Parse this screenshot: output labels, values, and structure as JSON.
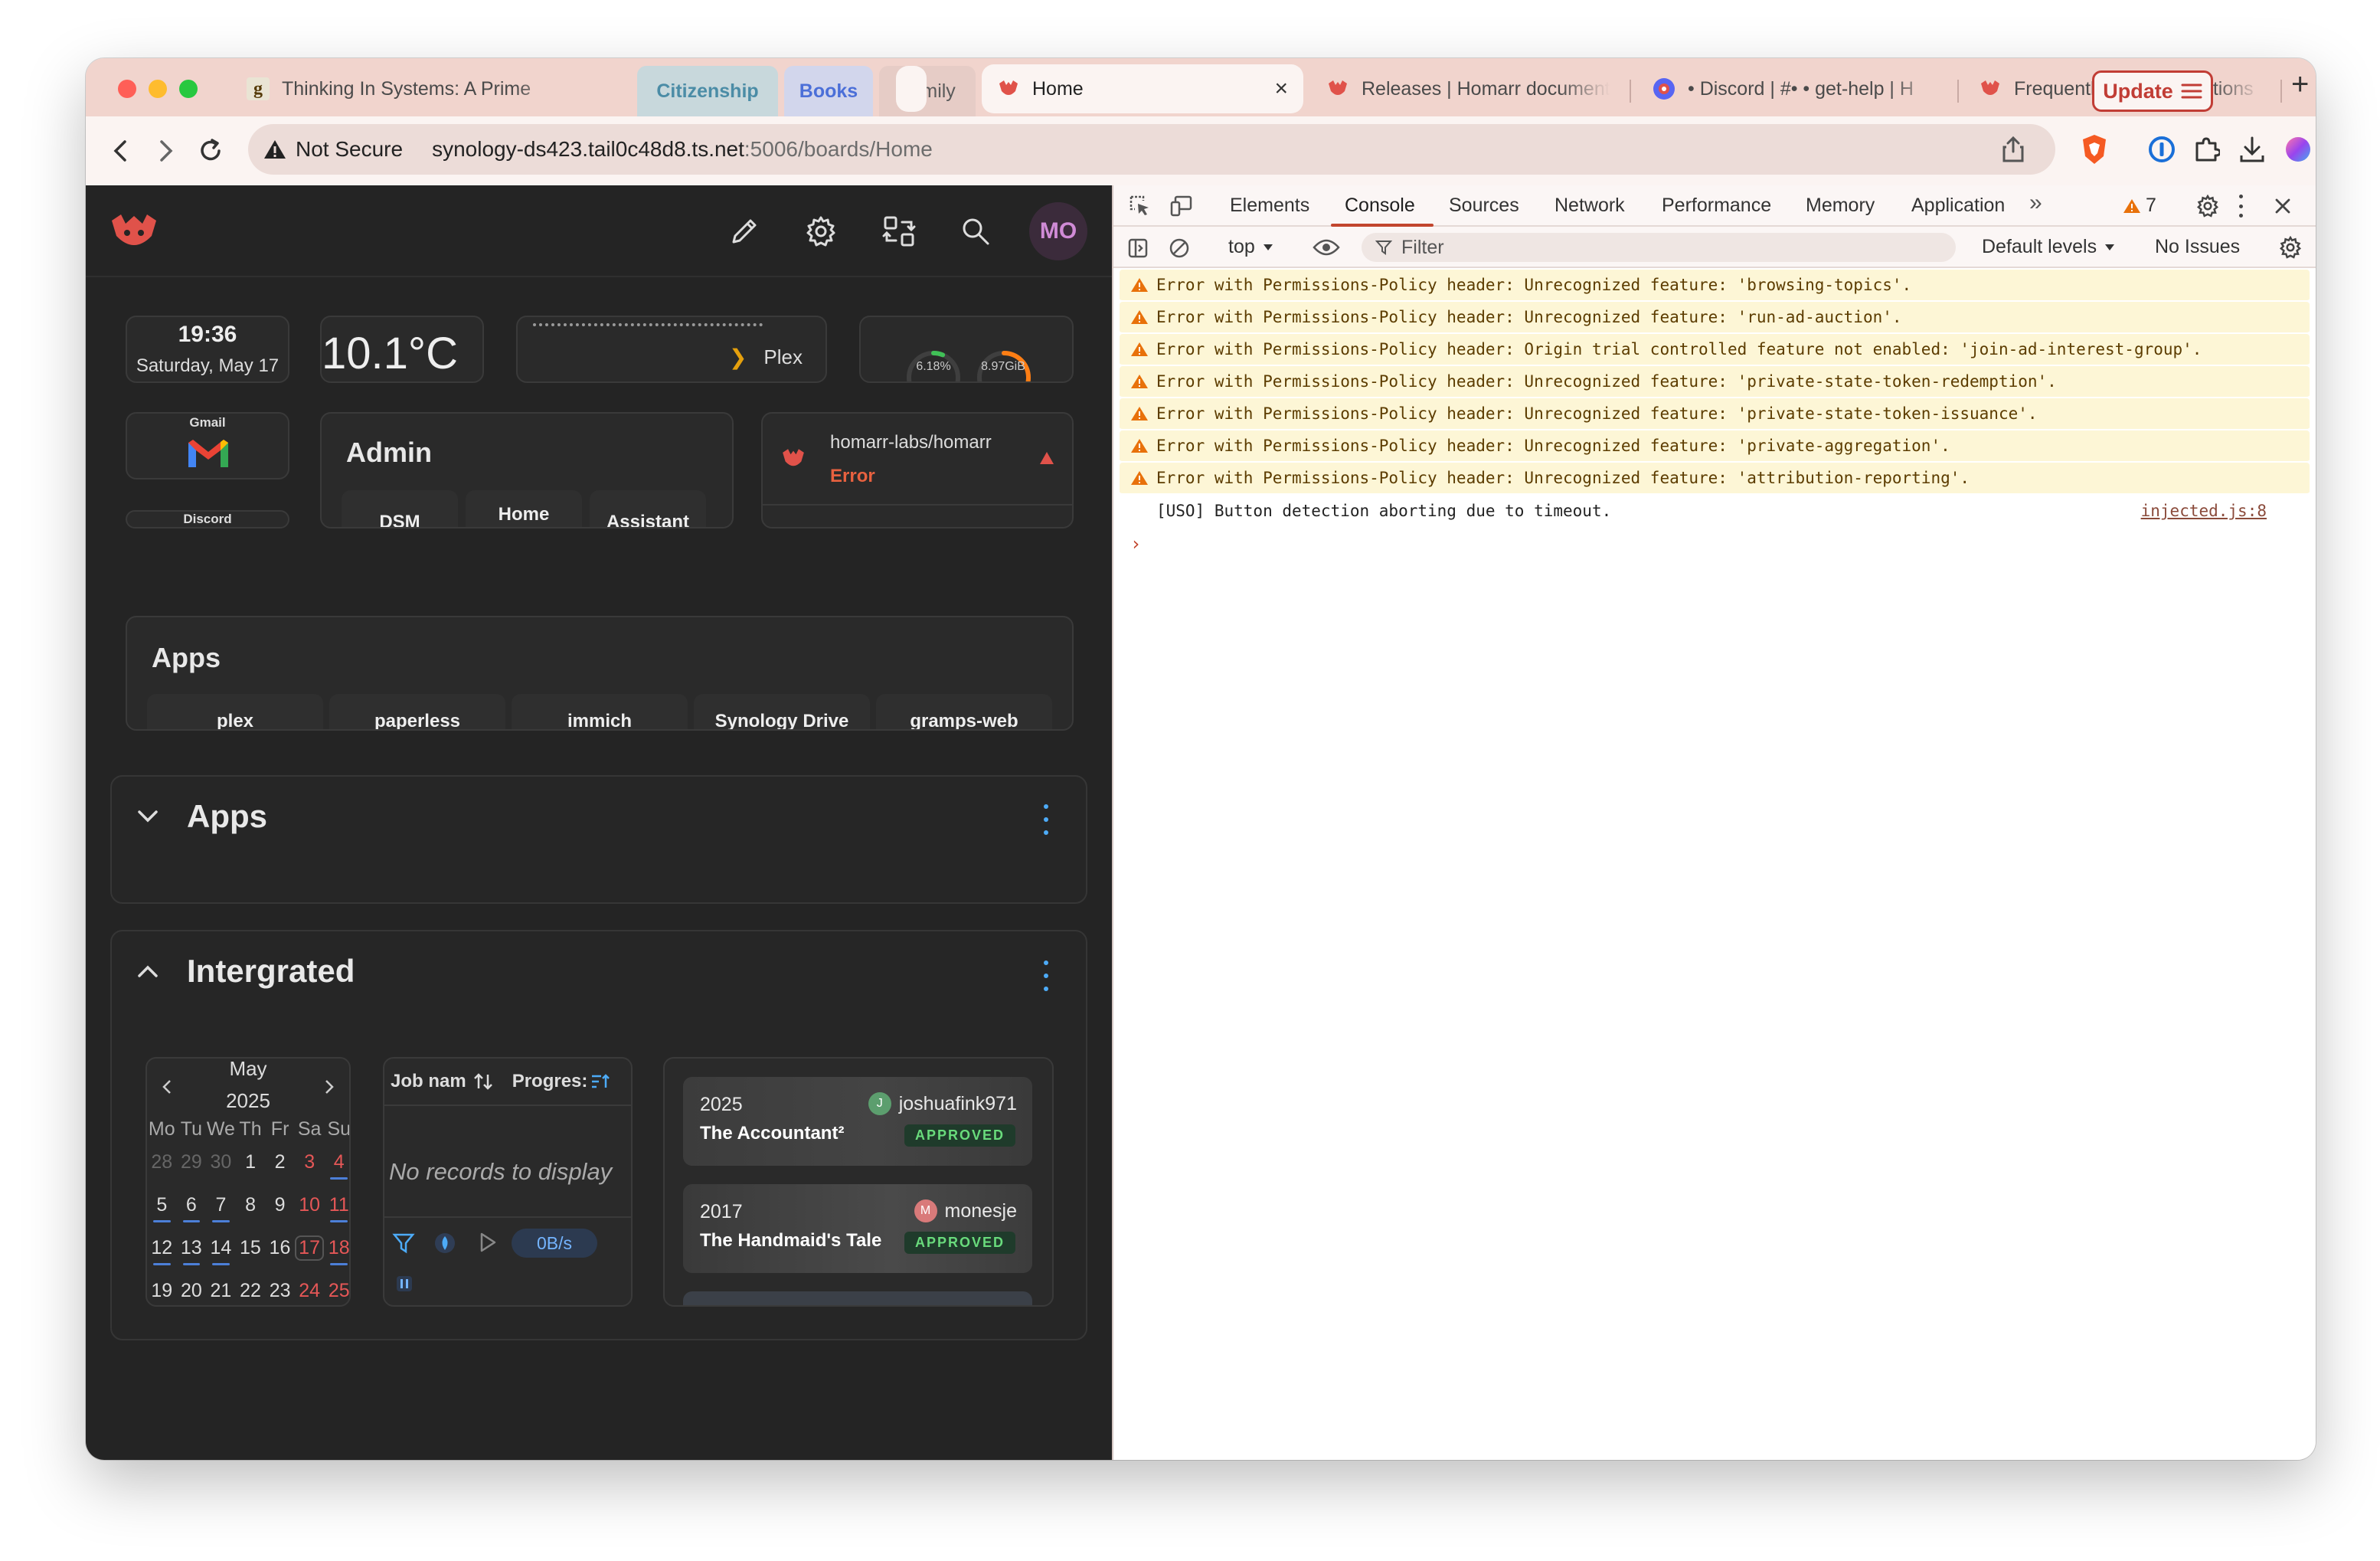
{
  "browser": {
    "tabs": [
      {
        "label": "Thinking In Systems: A Prime",
        "favicon": "goodreads-g"
      },
      {
        "label": "Citizenship",
        "group": true,
        "color": "#4b8ca6",
        "bg": "#c8d8dc"
      },
      {
        "label": "Books",
        "group": true,
        "color": "#4b6fd8",
        "bg": "#d2d6ec"
      },
      {
        "label": "Family",
        "group": true,
        "color": "#5a5a5a",
        "bg": "#e6ccc6"
      },
      {
        "label": "Home",
        "active": true
      },
      {
        "label": "Releases | Homarr document"
      },
      {
        "label": "• Discord | #• • get-help | H"
      },
      {
        "label": "Frequently Asked Questions"
      }
    ],
    "new_tab": "+",
    "close": "×",
    "not_secure": "Not Secure",
    "url_host": "synology-ds423.tail0c48d8.ts.net",
    "url_path": ":5006/boards/Home",
    "update_label": "Update"
  },
  "homarr": {
    "clock": {
      "time": "19:36",
      "date": "Saturday, May 17"
    },
    "weather": {
      "temp": "10.1°C"
    },
    "media_bar": {
      "label": "Plex"
    },
    "system": {
      "cpu": "6.18%",
      "cpu_fraction": 0.0618,
      "mem": "8.97GiB",
      "mem_fraction": 0.45
    },
    "gmail": {
      "label": "Gmail"
    },
    "discord": {
      "label": "Discord"
    },
    "admin": {
      "title": "Admin",
      "buttons": [
        "DSM",
        "Home",
        "Assistant"
      ]
    },
    "github": {
      "repo": "homarr-labs/homarr",
      "status": "Error"
    },
    "apps_card": {
      "title": "Apps",
      "items": [
        "plex",
        "paperless",
        "immich",
        "Synology Drive",
        "gramps-web"
      ]
    },
    "sections": [
      {
        "title": "Apps",
        "collapsed": true
      },
      {
        "title": "Intergrated",
        "collapsed": false
      }
    ],
    "calendar": {
      "month": "May",
      "year": "2025",
      "weekdays": [
        "Mo",
        "Tu",
        "We",
        "Th",
        "Fr",
        "Sa",
        "Su"
      ],
      "rows": [
        [
          "28",
          "29",
          "30",
          "1",
          "2",
          "3",
          "4"
        ],
        [
          "5",
          "6",
          "7",
          "8",
          "9",
          "10",
          "11"
        ],
        [
          "12",
          "13",
          "14",
          "15",
          "16",
          "17",
          "18"
        ],
        [
          "19",
          "20",
          "21",
          "22",
          "23",
          "24",
          "25"
        ]
      ]
    },
    "downloads": {
      "col_job": "Job nam",
      "col_progress": "Progres:",
      "empty": "No records to display",
      "speed": "0B/s"
    },
    "requests": [
      {
        "year": "2025",
        "title": "The Accountant²",
        "user": "joshuafink971",
        "user_initial": "J",
        "user_color": "#5c9e6e",
        "status": "APPROVED"
      },
      {
        "year": "2017",
        "title": "The Handmaid's Tale",
        "user": "monesje",
        "user_initial": "M",
        "user_color": "#d97a7a",
        "status": "APPROVED"
      }
    ],
    "avatar": "MO"
  },
  "devtools": {
    "tabs": [
      "Elements",
      "Console",
      "Sources",
      "Network",
      "Performance",
      "Memory",
      "Application"
    ],
    "warning_count": "7",
    "context": "top",
    "filter_placeholder": "Filter",
    "levels": "Default levels",
    "issues": "No Issues",
    "warnings": [
      "Error with Permissions-Policy header: Unrecognized feature: 'browsing-topics'.",
      "Error with Permissions-Policy header: Unrecognized feature: 'run-ad-auction'.",
      "Error with Permissions-Policy header: Origin trial controlled feature not enabled: 'join-ad-interest-group'.",
      "Error with Permissions-Policy header: Unrecognized feature: 'private-state-token-redemption'.",
      "Error with Permissions-Policy header: Unrecognized feature: 'private-state-token-issuance'.",
      "Error with Permissions-Policy header: Unrecognized feature: 'private-aggregation'.",
      "Error with Permissions-Policy header: Unrecognized feature: 'attribution-reporting'."
    ],
    "log": {
      "text": "[USO] Button detection aborting due to timeout.",
      "source": "injected.js:8"
    },
    "prompt": "›"
  }
}
